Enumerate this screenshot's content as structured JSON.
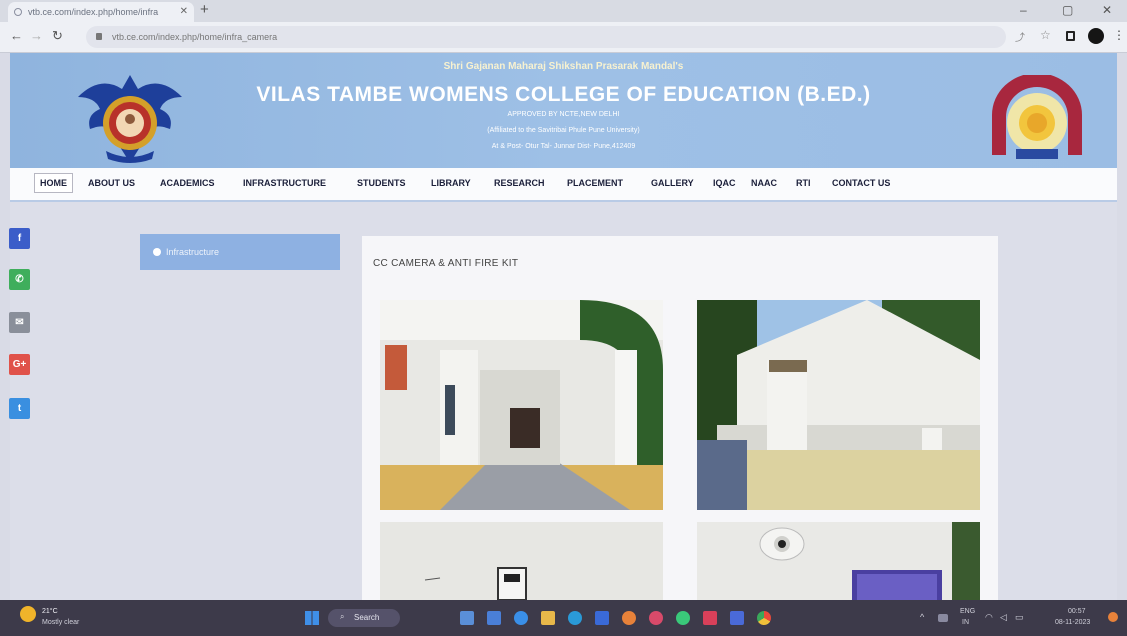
{
  "browser": {
    "tab_title": "vtb.ce.com/index.php/home/infra",
    "url": "vtb.ce.com/index.php/home/infra_camera"
  },
  "banner": {
    "society": "Shri Gajanan Maharaj Shikshan Prasarak Mandal's",
    "college": "VILAS TAMBE WOMENS COLLEGE OF EDUCATION (B.ED.)",
    "approved": "APPROVED BY NCTE,NEW DELHI",
    "affiliated": "(Affiliated to the Savitribai Phule Pune University)",
    "address": "At & Post- Otur Tal- Junnar Dist- Pune,412409"
  },
  "nav": {
    "items": [
      "HOME",
      "ABOUT US",
      "ACADEMICS",
      "INFRASTRUCTURE",
      "STUDENTS",
      "LIBRARY",
      "RESEARCH",
      "PLACEMENT",
      "GALLERY",
      "IQAC",
      "NAAC",
      "RTI",
      "CONTACT US"
    ],
    "active": "HOME"
  },
  "share": [
    {
      "icon": "facebook-icon",
      "glyph": "f",
      "color": "#3b5dc9"
    },
    {
      "icon": "whatsapp-icon",
      "glyph": "✆",
      "color": "#3fae5c"
    },
    {
      "icon": "email-icon",
      "glyph": "✉",
      "color": "#8a8f9a"
    },
    {
      "icon": "google-plus-icon",
      "glyph": "G+",
      "color": "#e0524a"
    },
    {
      "icon": "twitter-icon",
      "glyph": "t",
      "color": "#3a8fe0"
    }
  ],
  "sidebar": {
    "item": "Infrastructure"
  },
  "main": {
    "title": "CC CAMERA & ANTI FIRE KIT"
  },
  "taskbar": {
    "weather_temp": "21°C",
    "weather_desc": "Mostly clear",
    "search": "Search",
    "lang_top": "ENG",
    "lang_bottom": "IN",
    "time": "00:57",
    "date": "08-11-2023"
  }
}
